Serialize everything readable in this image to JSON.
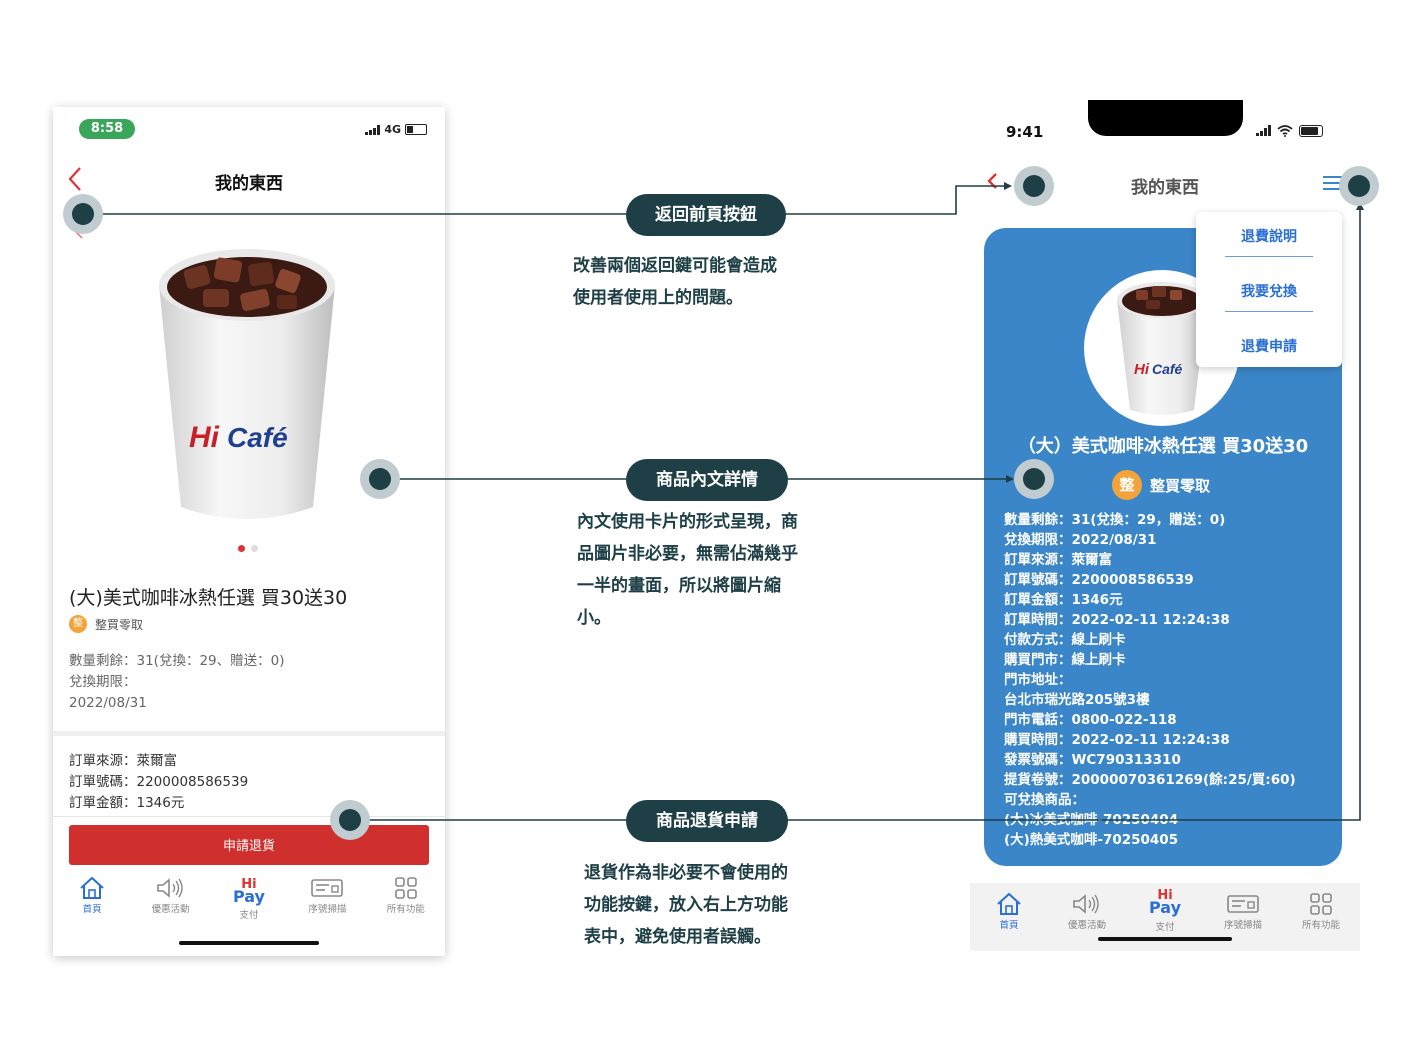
{
  "left_phone": {
    "status_time": "8:58",
    "network": "4G",
    "title": "我的東西",
    "back_icon": "chevron-left-icon",
    "product_name": "(大)美式咖啡冰熱任選 買30送30",
    "badge_icon_text": "整",
    "badge_label": "整買零取",
    "remaining": "數量剩餘：31(兌換：29、贈送：0)",
    "expiry_label": "兌換期限：",
    "expiry_date": "2022/08/31",
    "order_source": "訂單來源：萊爾富",
    "order_number": "訂單號碼：2200008586539",
    "order_amount": "訂單金額：1346元",
    "refund_button": "申請退貨",
    "cup_brand": "Hi Café",
    "tabs": [
      {
        "label": "首頁",
        "icon": "home-icon"
      },
      {
        "label": "優惠活動",
        "icon": "speaker-icon"
      },
      {
        "label": "支付",
        "icon": "hipay-icon",
        "logo_top": "Hi",
        "logo_bottom": "Pay"
      },
      {
        "label": "序號掃描",
        "icon": "barcode-card-icon"
      },
      {
        "label": "所有功能",
        "icon": "grid-icon"
      }
    ],
    "accent_color": "#cf2f2d",
    "active_tab_color": "#2a6fd6"
  },
  "right_phone": {
    "status_time": "9:41",
    "title": "我的東西",
    "product_name": "（大）美式咖啡冰熱任選 買30送30",
    "badge_icon_text": "整",
    "badge_label": "整買零取",
    "details": [
      "數量剩餘：31(兌換：29，贈送：0)",
      "兌換期限：2022/08/31",
      "訂單來源：萊爾富",
      "訂單號碼：2200008586539",
      "訂單金額：1346元",
      "訂單時間：2022-02-11 12:24:38",
      "付款方式：線上刷卡",
      "購買門市：線上刷卡",
      "門市地址：",
      "台北市瑞光路205號3樓",
      "門市電話：0800-022-118",
      "購買時間：2022-02-11 12:24:38",
      "發票號碼：WC790313310",
      "提貨卷號：20000070361269(餘:25/買:60)",
      "可兌換商品：",
      "(大)冰美式咖啡-70250404",
      "(大)熱美式咖啡-70250405"
    ],
    "menu": [
      "退費說明",
      "我要兌換",
      "退費申請"
    ],
    "card_color": "#3b86c8",
    "tabs": [
      {
        "label": "首頁",
        "icon": "home-icon"
      },
      {
        "label": "優惠活動",
        "icon": "speaker-icon"
      },
      {
        "label": "支付",
        "icon": "hipay-icon",
        "logo_top": "Hi",
        "logo_bottom": "Pay"
      },
      {
        "label": "序號掃描",
        "icon": "barcode-card-icon"
      },
      {
        "label": "所有功能",
        "icon": "grid-icon"
      }
    ]
  },
  "annotations": [
    {
      "title": "返回前頁按鈕",
      "lines": [
        "改善兩個返回鍵可能會造成",
        "使用者使用上的問題。"
      ]
    },
    {
      "title": "商品內文詳情",
      "lines": [
        "內文使用卡片的形式呈現，商",
        "品圖片非必要，無需佔滿幾乎",
        "一半的畫面，所以將圖片縮",
        "小。"
      ]
    },
    {
      "title": "商品退貨申請",
      "lines": [
        "退貨作為非必要不會使用的",
        "功能按鍵，放入右上方功能",
        "表中，避免使用者誤觸。"
      ]
    }
  ],
  "annotation_color": "#1d3f45"
}
